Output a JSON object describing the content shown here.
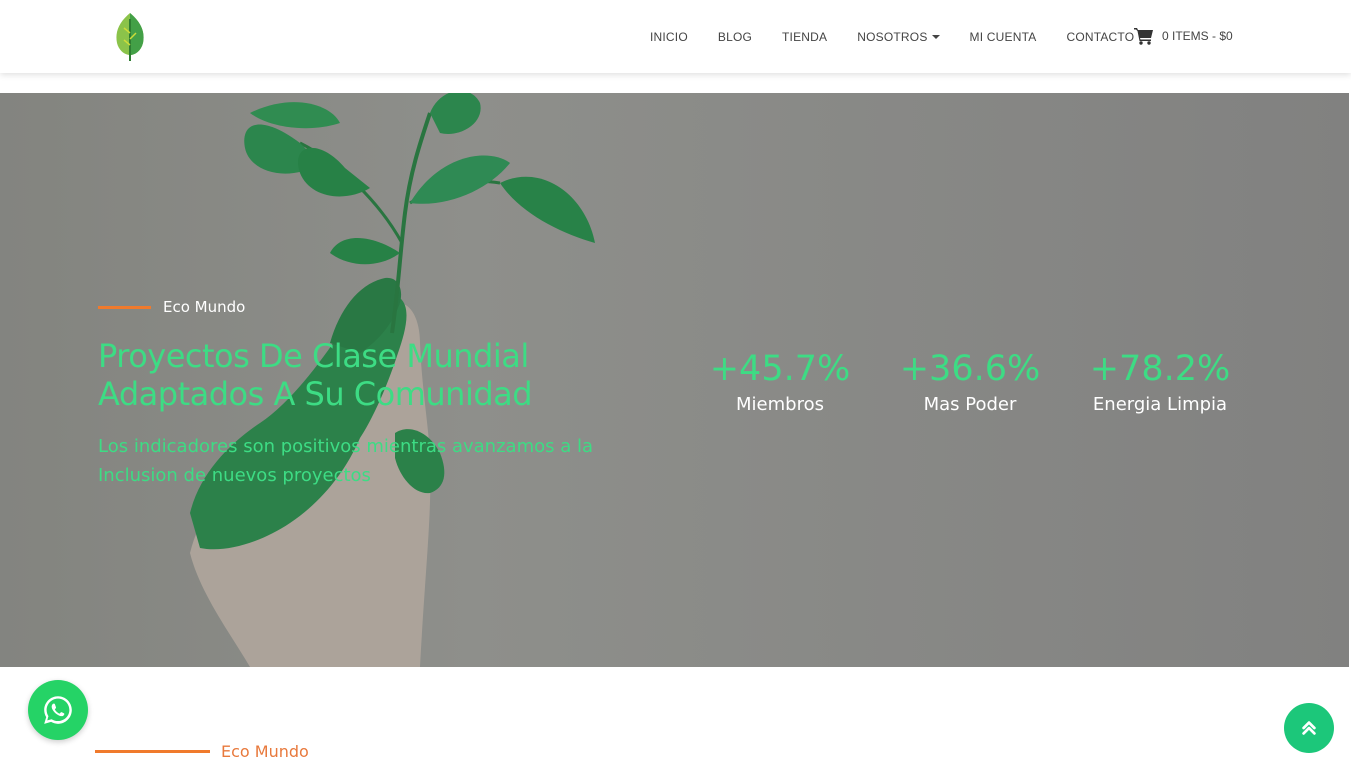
{
  "nav": {
    "items": [
      {
        "label": "INICIO"
      },
      {
        "label": "BLOG"
      },
      {
        "label": "TIENDA"
      },
      {
        "label": "NOSOTROS",
        "has_dropdown": true
      },
      {
        "label": "MI CUENTA"
      },
      {
        "label": "CONTACTO"
      }
    ],
    "cart_label": "0 ITEMS - $0"
  },
  "hero": {
    "eyebrow": "Eco Mundo",
    "title_line1": "Proyectos De Clase Mundial",
    "title_line2": "Adaptados A Su Comunidad",
    "subtitle": "Los indicadores son positivos mientras avanzamos a la Inclusion de nuevos proyectos",
    "stats": [
      {
        "value": "+45.7%",
        "label": "Miembros"
      },
      {
        "value": "+36.6%",
        "label": "Mas Poder"
      },
      {
        "value": "+78.2%",
        "label": "Energia Limpia"
      }
    ]
  },
  "section": {
    "eyebrow": "Eco Mundo"
  },
  "icons": {
    "logo": "leaf-logo-icon",
    "cart": "shopping-cart-icon",
    "whatsapp": "whatsapp-icon",
    "scroll_top": "double-chevron-up-icon"
  },
  "colors": {
    "accent_green": "#3ddc84",
    "accent_orange": "#f07a2c",
    "whatsapp_green": "#25d366"
  }
}
